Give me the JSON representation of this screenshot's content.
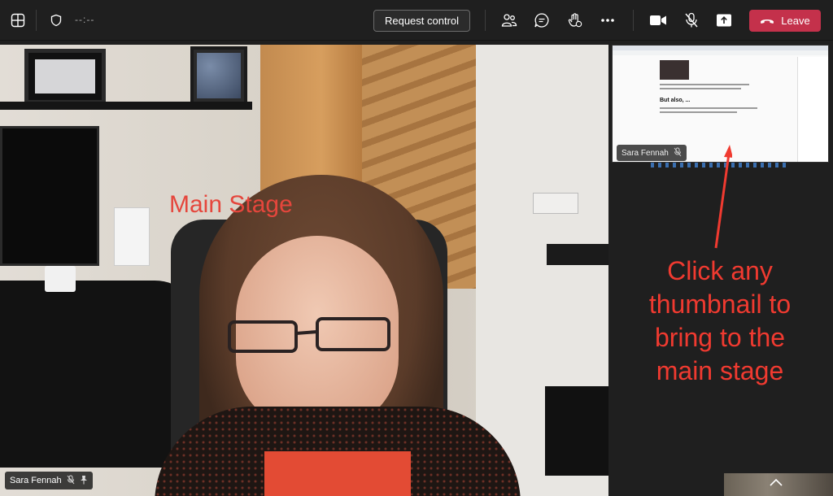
{
  "toolbar": {
    "timer": "--:--",
    "request_control_label": "Request control",
    "leave_label": "Leave",
    "icons": [
      "grid-layout-icon",
      "shield-icon",
      "people-icon",
      "chat-icon",
      "react-icon",
      "more-icon",
      "camera-icon",
      "mic-off-icon",
      "share-icon",
      "phone-icon"
    ]
  },
  "stage": {
    "label": "Main Stage",
    "participant_name": "Sara Fennah"
  },
  "thumbnail": {
    "participant_name": "Sara Fennah",
    "doc_heading": "But also, ..."
  },
  "annotation": {
    "text": "Click any thumbnail to bring to the main stage",
    "color": "#f03a30"
  },
  "colors": {
    "leave": "#c4314b",
    "background": "#1f1f1f",
    "stage_label": "#e5463c"
  }
}
